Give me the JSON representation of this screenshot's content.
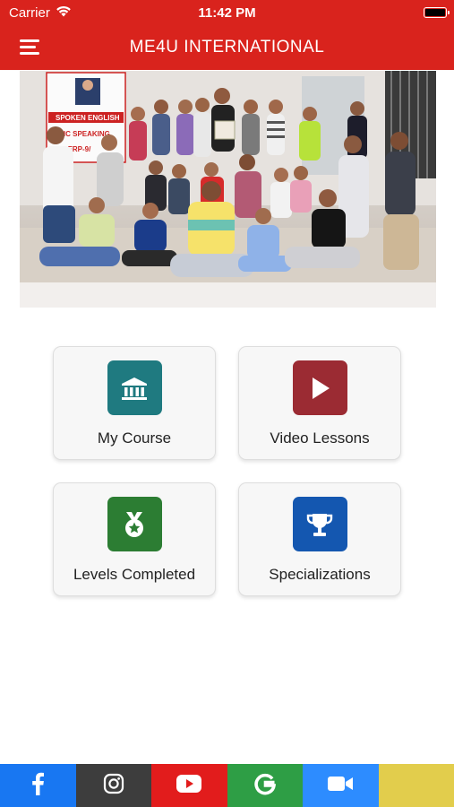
{
  "status_bar": {
    "carrier": "Carrier",
    "time": "11:42 PM"
  },
  "header": {
    "title": "ME4U INTERNATIONAL",
    "menu_icon": "hamburger-icon"
  },
  "banner": {
    "image": "group-photo",
    "poster_lines": [
      "SPOKEN ENGLISH",
      "LIC SPEAKING",
      "LY ERP-9/"
    ]
  },
  "tiles": [
    {
      "label": "My Course",
      "icon": "institution-icon",
      "color": "#1f7a80"
    },
    {
      "label": "Video Lessons",
      "icon": "play-icon",
      "color": "#9b2b33"
    },
    {
      "label": "Levels Completed",
      "icon": "medal-icon",
      "color": "#2c7d33"
    },
    {
      "label": "Specializations",
      "icon": "trophy-icon",
      "color": "#1457b0"
    }
  ],
  "social": [
    {
      "name": "facebook",
      "icon": "facebook-icon",
      "color": "#1877f2"
    },
    {
      "name": "instagram",
      "icon": "instagram-icon",
      "color": "#3d3d3d"
    },
    {
      "name": "youtube",
      "icon": "youtube-icon",
      "color": "#e21c1c"
    },
    {
      "name": "google",
      "icon": "google-icon",
      "color": "#2e9e45"
    },
    {
      "name": "zoom",
      "icon": "video-camera-icon",
      "color": "#2d8cff"
    },
    {
      "name": "extra",
      "icon": "",
      "color": "#e2cd4c"
    }
  ],
  "theme": {
    "header_color": "#d9231d"
  }
}
